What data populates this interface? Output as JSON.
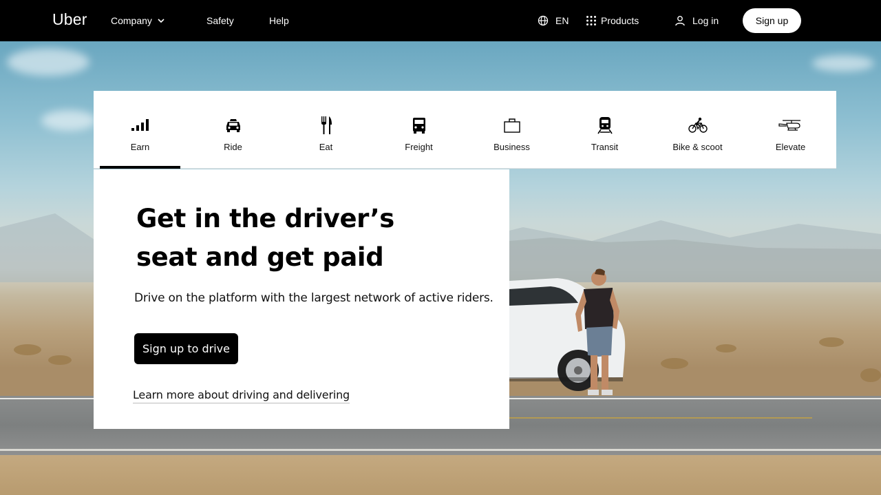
{
  "nav": {
    "logo": "Uber",
    "company": "Company",
    "safety": "Safety",
    "help": "Help",
    "language": "EN",
    "products": "Products",
    "login": "Log in",
    "signup": "Sign up"
  },
  "tabs": [
    {
      "label": "Earn",
      "icon": "signal-bars-icon",
      "active": true
    },
    {
      "label": "Ride",
      "icon": "car-icon",
      "active": false
    },
    {
      "label": "Eat",
      "icon": "fork-knife-icon",
      "active": false
    },
    {
      "label": "Freight",
      "icon": "truck-icon",
      "active": false
    },
    {
      "label": "Business",
      "icon": "briefcase-icon",
      "active": false
    },
    {
      "label": "Transit",
      "icon": "train-icon",
      "active": false
    },
    {
      "label": "Bike & scoot",
      "icon": "bike-icon",
      "active": false
    },
    {
      "label": "Elevate",
      "icon": "helicopter-icon",
      "active": false
    }
  ],
  "hero": {
    "headline_line1": "Get in the driver’s",
    "headline_line2": "seat and get paid",
    "subtext": "Drive on the platform with the largest network of active riders.",
    "cta": "Sign up to drive",
    "link": "Learn more about driving and delivering"
  },
  "colors": {
    "nav_bg": "#000000",
    "card_bg": "#ffffff",
    "button_bg": "#000000"
  }
}
